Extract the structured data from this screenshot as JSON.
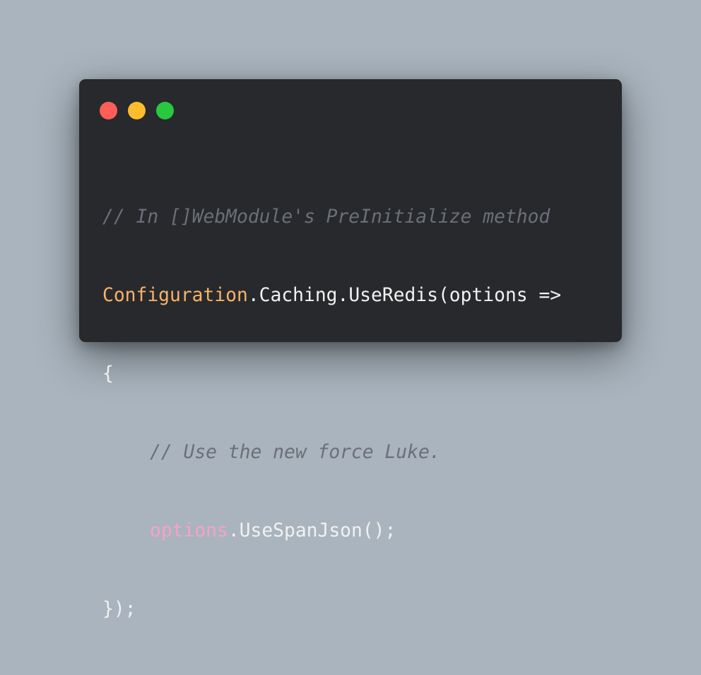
{
  "window": {
    "controls": [
      {
        "name": "close-control",
        "color": "#ff5f57"
      },
      {
        "name": "minimize-control",
        "color": "#febc2e"
      },
      {
        "name": "zoom-control",
        "color": "#28c840"
      }
    ]
  },
  "colors": {
    "comment": "#6b6f78",
    "identifier": "#f6b26b",
    "parameter": "#f5a3c7",
    "plain": "#f1f1f1",
    "background": "#28292c",
    "page": "#a9b4be"
  },
  "code": {
    "line1": {
      "comment": "// In []WebModule's PreInitialize method"
    },
    "line2": {
      "identifier": "Configuration",
      "rest": ".Caching.UseRedis(options =>"
    },
    "line3": {
      "text": "{"
    },
    "line4": {
      "comment": "// Use the new force Luke."
    },
    "line5": {
      "param": "options",
      "rest": ".UseSpanJson();"
    },
    "line6": {
      "text": "});"
    }
  }
}
